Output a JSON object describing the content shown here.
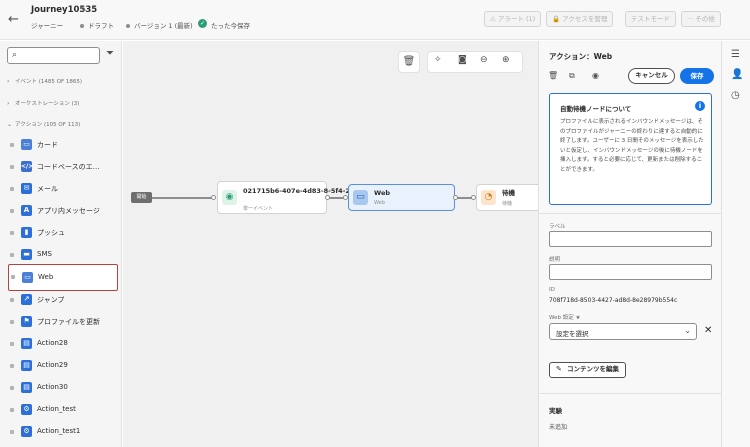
{
  "header": {
    "back_icon": "arrow-left-icon",
    "title": "Journey10535",
    "edit_icon": "pencil-icon",
    "type": "ジャーニー",
    "status": "ドラフト",
    "version": "バージョン 1 (最新)",
    "saved": "たった今保存",
    "buttons": {
      "alert": "アラート (1)",
      "manage_access": "アクセスを管理",
      "test_mode": "テストモード",
      "more": "その他"
    }
  },
  "sidebar": {
    "search_placeholder": "",
    "sections": {
      "events": "イベント (1485 OF 1865)",
      "orchestration": "オーケストレーション (3)",
      "actions": "アクション (105 OF 113)"
    },
    "items": [
      {
        "label": "カード",
        "icon": "card-icon",
        "color": "#4b7fd8"
      },
      {
        "label": "コードベースのエ…",
        "icon": "code-icon",
        "color": "#3d6fd0"
      },
      {
        "label": "メール",
        "icon": "mail-icon",
        "color": "#2c6fd8"
      },
      {
        "label": "アプリ内メッセージ",
        "icon": "in-app-icon",
        "color": "#2c6fd8"
      },
      {
        "label": "プッシュ",
        "icon": "push-icon",
        "color": "#2c6fd8"
      },
      {
        "label": "SMS",
        "icon": "sms-icon",
        "color": "#2c6fd8"
      },
      {
        "label": "Web",
        "icon": "web-icon",
        "color": "#4b7fd8"
      },
      {
        "label": "ジャンプ",
        "icon": "jump-icon",
        "color": "#2c6fd8"
      },
      {
        "label": "プロファイルを更新",
        "icon": "profile-update-icon",
        "color": "#2c6fd8"
      },
      {
        "label": "Action28",
        "icon": "custom-action-icon",
        "color": "#2c6fd8"
      },
      {
        "label": "Action29",
        "icon": "custom-action-icon",
        "color": "#2c6fd8"
      },
      {
        "label": "Action30",
        "icon": "custom-action-icon",
        "color": "#2c6fd8"
      },
      {
        "label": "Action_test",
        "icon": "custom-action-gear-icon",
        "color": "#2c6fd8"
      },
      {
        "label": "Action_test1",
        "icon": "custom-action-gear-icon",
        "color": "#2c6fd8"
      }
    ]
  },
  "canvas": {
    "start_label": "開始",
    "nodes": [
      {
        "title": "021715b6-407e-4d83-8-5f4-2c625d",
        "subtitle": "単一イベント",
        "icon": "event-icon"
      },
      {
        "title": "Web",
        "subtitle": "Web",
        "icon": "web-icon"
      },
      {
        "title": "待機",
        "subtitle": "待機",
        "icon": "clock-icon"
      }
    ]
  },
  "panel": {
    "title": "アクション：Web",
    "cancel": "キャンセル",
    "save": "保存",
    "info_title": "自動待機ノードについて",
    "info_body": "プロファイルに表示されるインバウンドメッセージは、そのプロファイルがジャーニーの終わりに達すると自動的に終了します。ユーザーに 3 日間そのメッセージを表示したいと仮定し、インバウンドメッセージの後に待機ノードを挿入します。すると必要に応じて、更新または削除することができます。",
    "label_label": "ラベル",
    "label_value": "",
    "description_label": "説明",
    "description_value": "",
    "id_label": "ID",
    "id_value": "708f718d-8503-4427-ad8d-8e28979b554c",
    "web_config_label": "Web 設定 ★",
    "web_config_value": "設定を選択",
    "edit_content": "コンテンツを編集",
    "experiment_title": "実験",
    "experiment_value": "未追加"
  },
  "colors": {
    "accent": "#1473e6",
    "selection_outline": "#b3433f",
    "success": "#2d9d78"
  }
}
